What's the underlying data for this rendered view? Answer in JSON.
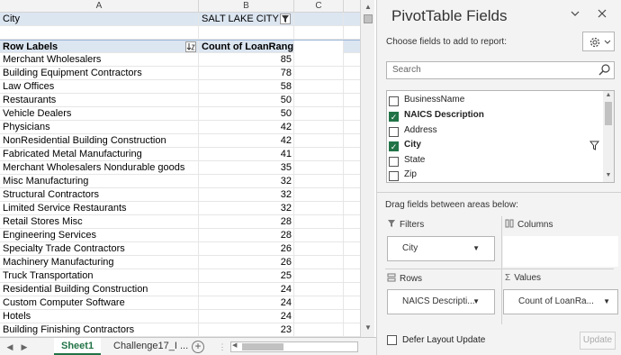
{
  "sheet": {
    "columns": [
      "A",
      "B",
      "C"
    ],
    "filter_row": {
      "label": "City",
      "value": "SALT LAKE CITY"
    },
    "header_row": {
      "row_labels": "Row Labels",
      "count_label": "Count of LoanRange"
    },
    "rows": [
      {
        "label": "Merchant Wholesalers",
        "count": "85"
      },
      {
        "label": "Building Equipment Contractors",
        "count": "78"
      },
      {
        "label": "Law Offices",
        "count": "58"
      },
      {
        "label": "Restaurants",
        "count": "50"
      },
      {
        "label": "Vehicle Dealers",
        "count": "50"
      },
      {
        "label": "Physicians",
        "count": "42"
      },
      {
        "label": "NonResidential Building Construction",
        "count": "42"
      },
      {
        "label": "Fabricated Metal Manufacturing",
        "count": "41"
      },
      {
        "label": "Merchant Wholesalers Nondurable goods",
        "count": "35"
      },
      {
        "label": "Misc Manufacturing",
        "count": "32"
      },
      {
        "label": "Structural Contractors",
        "count": "32"
      },
      {
        "label": "Limited Service Restaurants",
        "count": "32"
      },
      {
        "label": "Retail Stores Misc",
        "count": "28"
      },
      {
        "label": "Engineering Services",
        "count": "28"
      },
      {
        "label": "Specialty Trade Contractors",
        "count": "26"
      },
      {
        "label": "Machinery Manufacturing",
        "count": "26"
      },
      {
        "label": "Truck Transportation",
        "count": "25"
      },
      {
        "label": "Residential Building Construction",
        "count": "24"
      },
      {
        "label": "Custom Computer Software",
        "count": "24"
      },
      {
        "label": "Hotels",
        "count": "24"
      },
      {
        "label": "Building Finishing Contractors",
        "count": "23"
      }
    ]
  },
  "tabs": {
    "active": "Sheet1",
    "other": "Challenge17_I ..."
  },
  "pane": {
    "title": "PivotTable Fields",
    "choose_label": "Choose fields to add to report:",
    "search_placeholder": "Search",
    "fields": [
      {
        "name": "BusinessName",
        "checked": false,
        "bold": false
      },
      {
        "name": "NAICS Description",
        "checked": true,
        "bold": true
      },
      {
        "name": "Address",
        "checked": false,
        "bold": false
      },
      {
        "name": "City",
        "checked": true,
        "bold": true,
        "filtered": true
      },
      {
        "name": "State",
        "checked": false,
        "bold": false
      },
      {
        "name": "Zip",
        "checked": false,
        "bold": false
      }
    ],
    "drag_label": "Drag fields between areas below:",
    "areas": {
      "filters": {
        "title": "Filters",
        "item": "City"
      },
      "columns": {
        "title": "Columns"
      },
      "rows": {
        "title": "Rows",
        "item": "NAICS Descripti..."
      },
      "values": {
        "title": "Values",
        "item": "Count of LoanRa..."
      }
    },
    "defer_label": "Defer Layout Update",
    "update_label": "Update"
  },
  "colors": {
    "accent": "#217346",
    "pivot_header": "#dce6f1"
  }
}
